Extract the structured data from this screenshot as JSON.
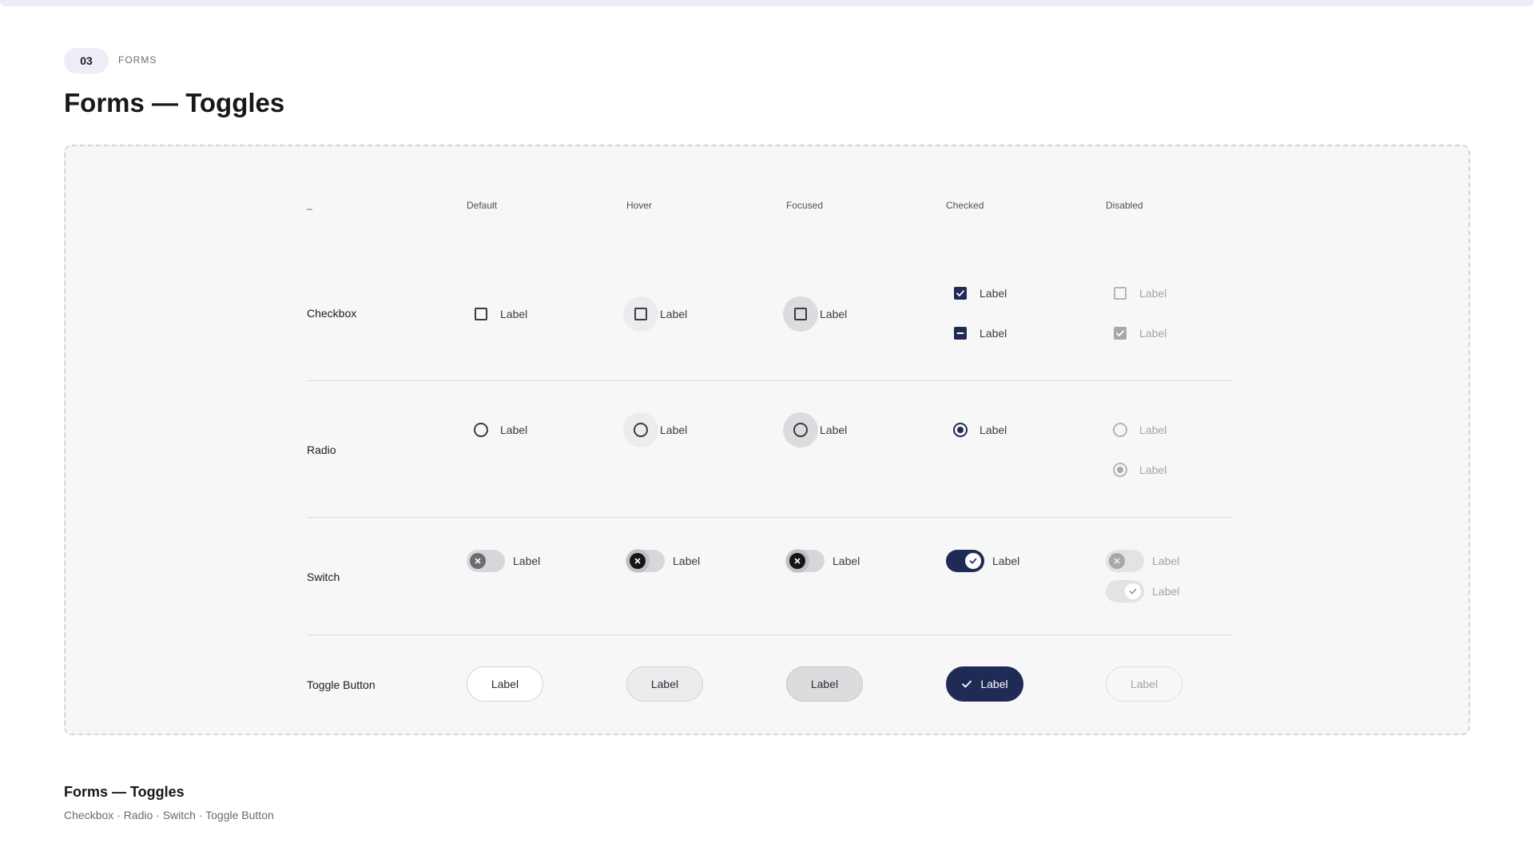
{
  "header": {
    "section_number": "03",
    "section_label": "FORMS",
    "title": "Forms — Toggles"
  },
  "table": {
    "corner": "–",
    "columns": [
      "Default",
      "Hover",
      "Focused",
      "Checked",
      "Disabled"
    ],
    "rows": [
      "Checkbox",
      "Radio",
      "Switch",
      "Toggle Button"
    ],
    "control_label": "Label"
  },
  "footer": {
    "title": "Forms — Toggles",
    "subtitle": "Checkbox · Radio · Switch · Toggle Button"
  },
  "colors": {
    "accent": "#1f2a55",
    "canvas_bg": "#f7f7f7",
    "pill_bg": "#eeedf7"
  }
}
